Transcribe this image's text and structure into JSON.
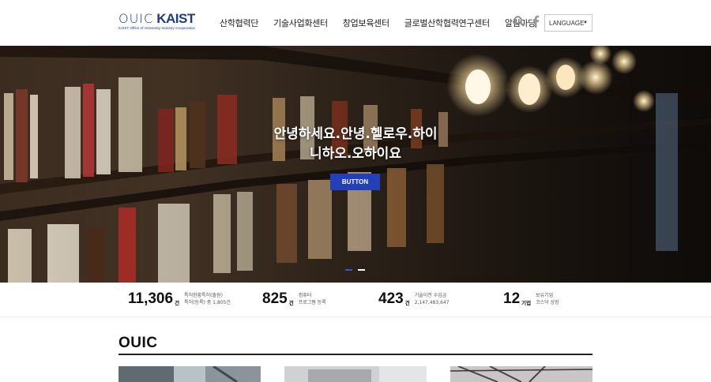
{
  "header": {
    "logo": {
      "ouic": "OUIC",
      "kaist": "KAIST",
      "subtitle": "KAIST Office of University-Industry Cooperation"
    },
    "nav": [
      {
        "label": "산학협력단"
      },
      {
        "label": "기술사업화센터"
      },
      {
        "label": "창업보육센터"
      },
      {
        "label": "글로벌산학협력연구센터"
      },
      {
        "label": "알림마당"
      }
    ],
    "language": {
      "label": "LANGUAGE"
    }
  },
  "hero": {
    "title_line1": "안녕하세요.안녕.헬로우.하이",
    "title_line2": "니하오.오하이요",
    "button_label": "BUTTON"
  },
  "stats": [
    {
      "number": "11,306",
      "unit": "건",
      "desc1": "특허현황특허(출원)",
      "desc2": "특허(등록) 중 1,805건"
    },
    {
      "number": "825",
      "unit": "건",
      "desc1": "컴퓨터",
      "desc2": "프로그램 등록"
    },
    {
      "number": "423",
      "unit": "건",
      "desc1": "기술이전 수입금",
      "desc2": "2,147,483,647"
    },
    {
      "number": "12",
      "unit": "기업",
      "desc1": "보유기업",
      "desc2": "코스닥 상장"
    }
  ],
  "section": {
    "title": "OUIC"
  },
  "colors": {
    "brand": "#1f3a8a",
    "button": "#2440b8"
  }
}
